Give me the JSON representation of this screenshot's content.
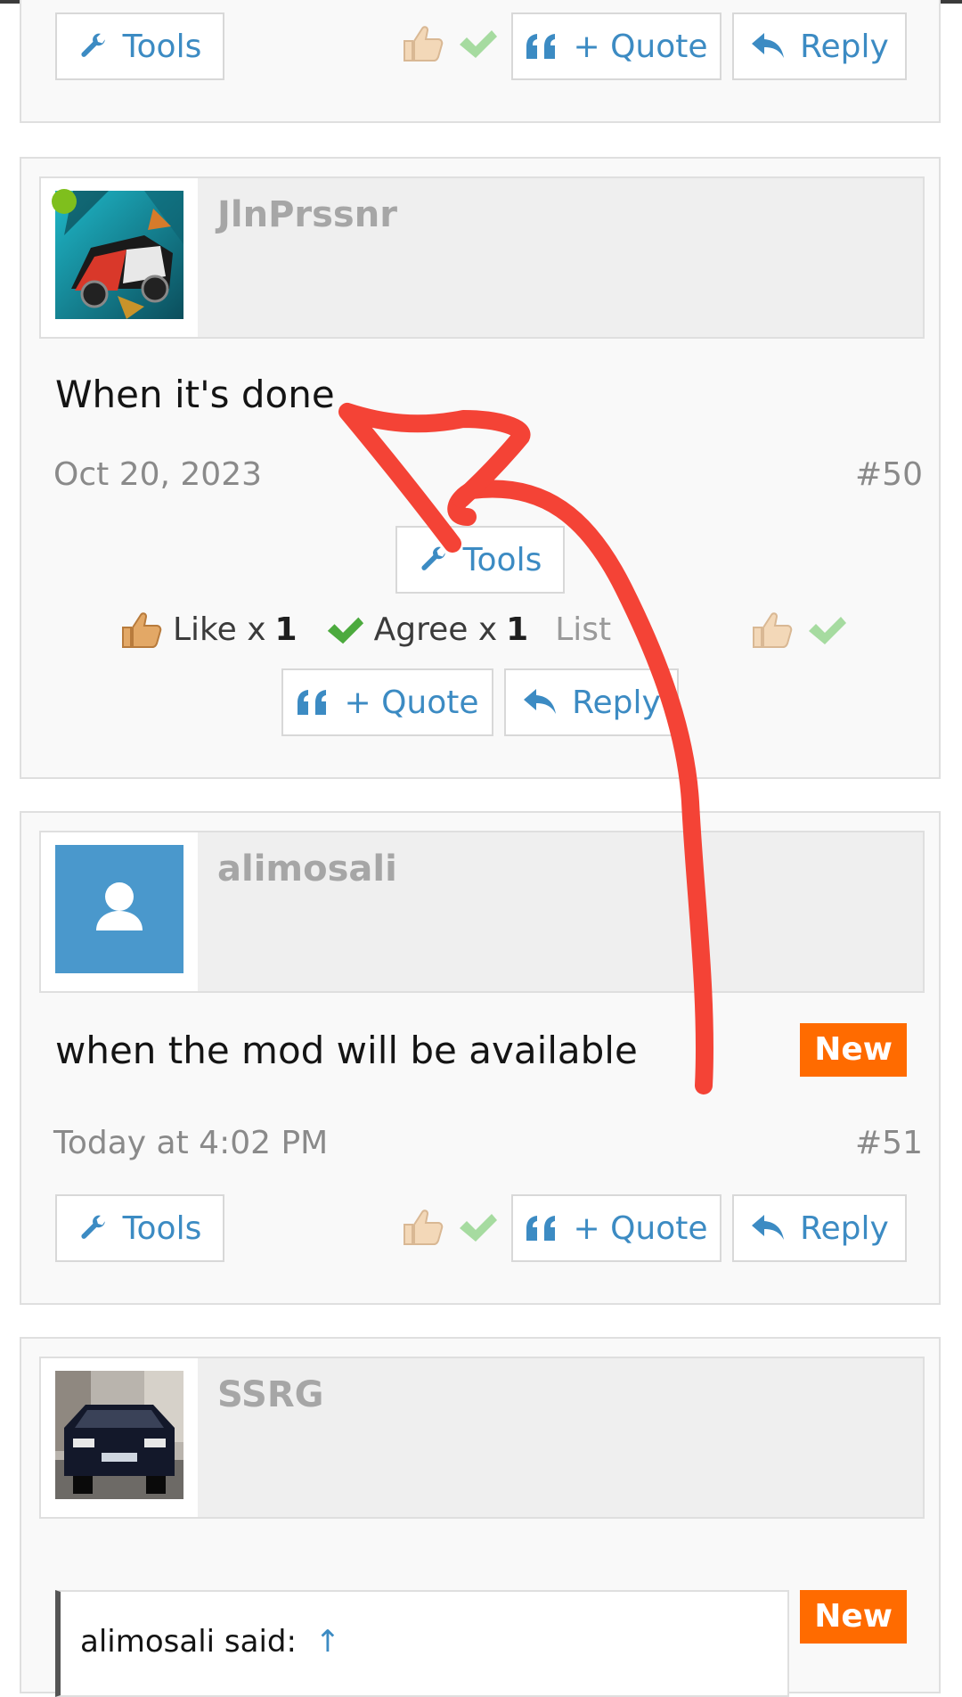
{
  "buttons": {
    "tools": "Tools",
    "quote": "+ Quote",
    "reply": "Reply"
  },
  "posts": [
    {
      "username": "JlnPrssnr",
      "message": "When it's done",
      "date": "Oct 20, 2023",
      "number": "#50",
      "reactions": {
        "like_label": "Like x",
        "like_count": "1",
        "agree_label": "Agree x",
        "agree_count": "1",
        "list_label": "List"
      }
    },
    {
      "username": "alimosali",
      "message": "when the mod will be available",
      "badge": "New",
      "date": "Today at 4:02 PM",
      "number": "#51"
    },
    {
      "username": "SSRG",
      "badge": "New",
      "quote_attribution": "alimosali said:",
      "quote_arrow": "↑"
    }
  ],
  "colors": {
    "link": "#3c8bc3",
    "badge": "#ff6b00",
    "online": "#7fbf1d",
    "annotation": "#f44336"
  }
}
